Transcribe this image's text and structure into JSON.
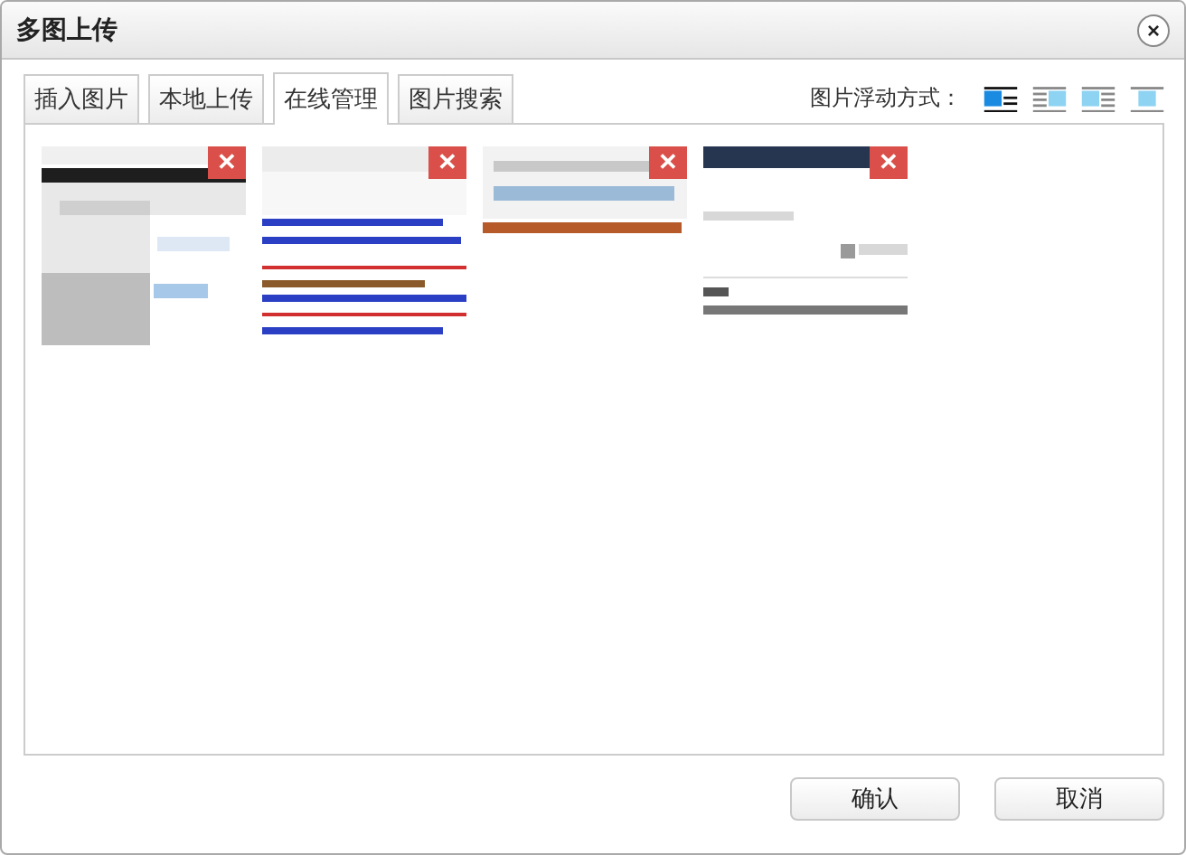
{
  "window": {
    "title": "多图上传",
    "close": "×"
  },
  "tabs": [
    {
      "label": "插入图片",
      "selected": false
    },
    {
      "label": "本地上传",
      "selected": false
    },
    {
      "label": "在线管理",
      "selected": true
    },
    {
      "label": "图片搜索",
      "selected": false
    }
  ],
  "float": {
    "label": "图片浮动方式：",
    "options": [
      {
        "kind": "left",
        "selected": true
      },
      {
        "kind": "right",
        "selected": false
      },
      {
        "kind": "none",
        "selected": false
      },
      {
        "kind": "center",
        "selected": false
      }
    ]
  },
  "images": [
    {
      "kind": "picture",
      "delete": "✕"
    },
    {
      "kind": "picture",
      "delete": "✕"
    },
    {
      "kind": "picture",
      "delete": "✕"
    },
    {
      "kind": "picture",
      "delete": "✕"
    }
  ],
  "buttons": [
    "确认",
    "取消"
  ]
}
